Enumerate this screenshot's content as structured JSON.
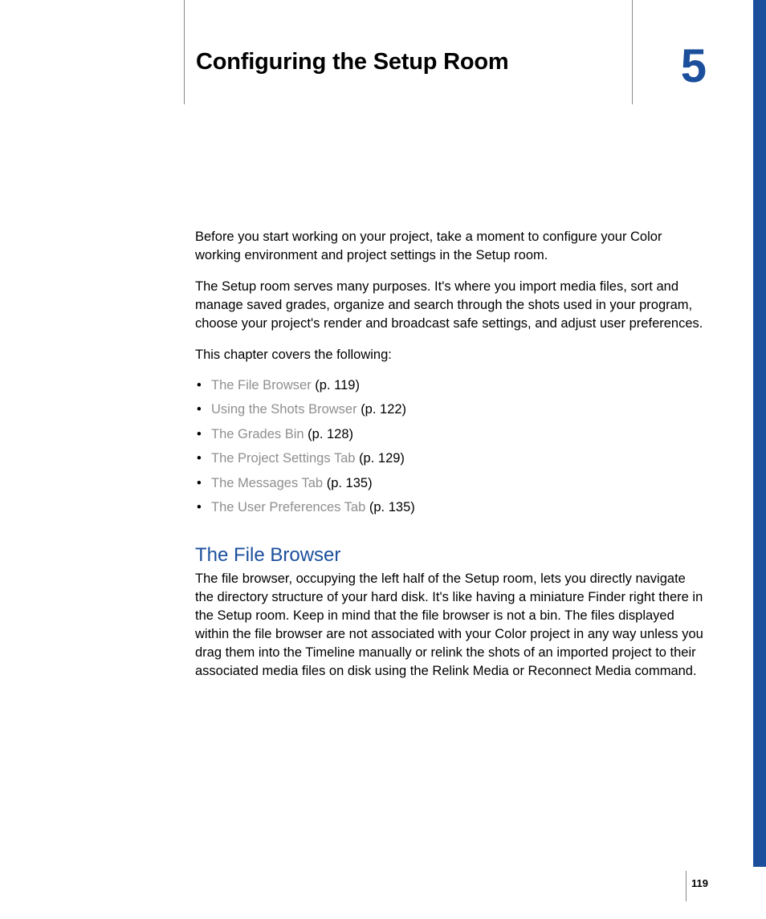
{
  "chapter": {
    "number": "5",
    "title": "Configuring the Setup Room"
  },
  "intro": {
    "p1": "Before you start working on your project, take a moment to configure your Color working environment and project settings in the Setup room.",
    "p2": "The Setup room serves many purposes. It's where you import media files, sort and manage saved grades, organize and search through the shots used in your program, choose your project's render and broadcast safe settings, and adjust user preferences.",
    "toc_intro": "This chapter covers the following:"
  },
  "toc": [
    {
      "label": "The File Browser",
      "page": "(p. 119)"
    },
    {
      "label": "Using the Shots Browser",
      "page": "(p. 122)"
    },
    {
      "label": "The Grades Bin",
      "page": "(p. 128)"
    },
    {
      "label": "The Project Settings Tab",
      "page": "(p. 129)"
    },
    {
      "label": "The Messages Tab",
      "page": "(p. 135)"
    },
    {
      "label": "The User Preferences Tab",
      "page": "(p. 135)"
    }
  ],
  "section": {
    "heading": "The File Browser",
    "body": "The file browser, occupying the left half of the Setup room, lets you directly navigate the directory structure of your hard disk. It's like having a miniature Finder right there in the Setup room. Keep in mind that the file browser is not a bin. The files displayed within the file browser are not associated with your Color project in any way unless you drag them into the Timeline manually or relink the shots of an imported project to their associated media files on disk using the Relink Media or Reconnect Media command."
  },
  "page_number": "119"
}
